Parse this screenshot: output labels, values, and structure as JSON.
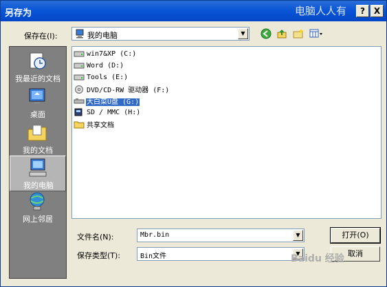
{
  "dialog": {
    "title": "另存为",
    "watermark_top": "电脑人人有",
    "help_button": "?",
    "close_button": "X"
  },
  "toolbar": {
    "save_in_label": "保存在(I):",
    "location": "我的电脑",
    "back_icon": "back-arrow-icon",
    "up_icon": "up-folder-icon",
    "newfolder_icon": "new-folder-icon",
    "views_icon": "views-menu-icon"
  },
  "places": [
    {
      "label": "我最近的文档",
      "icon": "recent-documents-icon"
    },
    {
      "label": "桌面",
      "icon": "desktop-icon"
    },
    {
      "label": "我的文档",
      "icon": "my-documents-icon"
    },
    {
      "label": "我的电脑",
      "icon": "my-computer-icon",
      "selected": true
    },
    {
      "label": "网上邻居",
      "icon": "network-places-icon"
    }
  ],
  "files": [
    {
      "label": "win7&XP (C:)",
      "icon": "hard-drive-icon"
    },
    {
      "label": "Word (D:)",
      "icon": "hard-drive-icon"
    },
    {
      "label": "Tools (E:)",
      "icon": "hard-drive-icon"
    },
    {
      "label": "DVD/CD-RW 驱动器 (F:)",
      "icon": "cd-drive-icon"
    },
    {
      "label": "大白菜U盘 (G:)",
      "icon": "removable-drive-icon",
      "selected": true
    },
    {
      "label": "SD / MMC (H:)",
      "icon": "sd-card-icon"
    },
    {
      "label": "共享文档",
      "icon": "folder-icon"
    }
  ],
  "bottom": {
    "filename_label": "文件名(N):",
    "filename_value": "Mbr.bin",
    "filetype_label": "保存类型(T):",
    "filetype_value": "Bin文件",
    "open_button": "打开(O)",
    "cancel_button": "取消"
  },
  "watermark_bottom": "Baidu 经验"
}
